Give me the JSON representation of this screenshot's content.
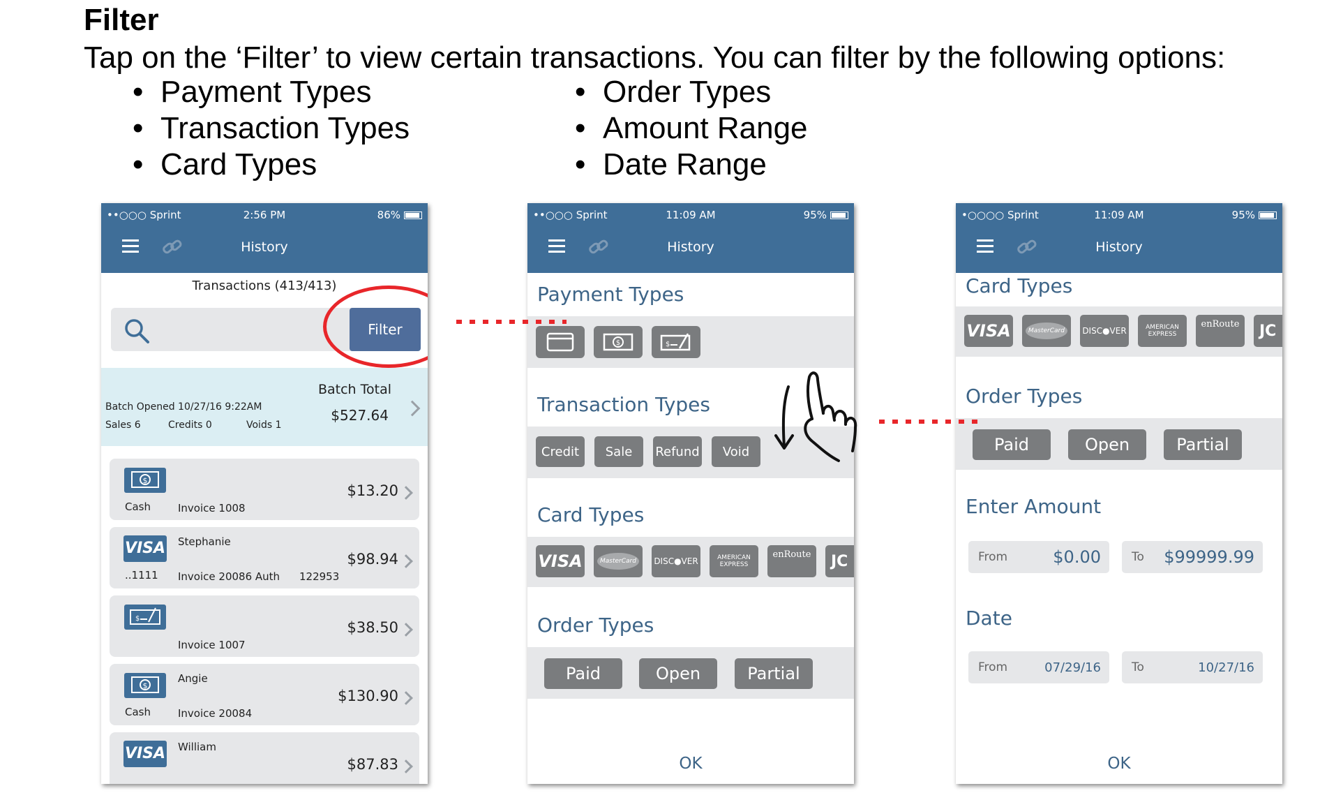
{
  "doc": {
    "title": "Filter",
    "intro": "Tap on the ‘Filter’ to view certain transactions. You can filter by the following options:",
    "options_left": [
      "Payment Types",
      "Transaction Types",
      "Card Types"
    ],
    "options_right": [
      "Order Types",
      "Amount Range",
      "Date Range"
    ]
  },
  "phones": [
    {
      "carrier": "••○○○ Sprint",
      "time": "2:56 PM",
      "battery": "86%",
      "title": "History"
    },
    {
      "carrier": "••○○○ Sprint",
      "time": "11:09 AM",
      "battery": "95%",
      "title": "History"
    },
    {
      "carrier": "•○○○○ Sprint",
      "time": "11:09 AM",
      "battery": "95%",
      "title": "History"
    }
  ],
  "history": {
    "header": "Transactions (413/413)",
    "filter_label": "Filter",
    "batch": {
      "label": "Batch Total",
      "amount": "$527.64",
      "opened": "Batch Opened 10/27/16 9:22AM",
      "sales": "Sales 6",
      "credits": "Credits   0",
      "voids": "Voids   1"
    },
    "rows": [
      {
        "icon": "cash-icon",
        "name": "",
        "payment": "Cash",
        "invoice": "Invoice 1008",
        "auth": "",
        "amount": "$13.20"
      },
      {
        "icon": "visa-icon",
        "name": "Stephanie",
        "payment": "..1111",
        "invoice": "Invoice 20086  Auth",
        "auth": "122953",
        "amount": "$98.94"
      },
      {
        "icon": "check-icon",
        "name": "",
        "payment": "",
        "invoice": "Invoice 1007",
        "auth": "",
        "amount": "$38.50"
      },
      {
        "icon": "cash-icon",
        "name": "Angie",
        "payment": "Cash",
        "invoice": "Invoice 20084",
        "auth": "",
        "amount": "$130.90"
      },
      {
        "icon": "visa-icon",
        "name": "William",
        "payment": "",
        "invoice": "",
        "auth": "",
        "amount": "$87.83"
      }
    ]
  },
  "filter": {
    "payment_types": "Payment Types",
    "transaction_types": "Transaction Types",
    "transaction_chips": [
      "Credit",
      "Sale",
      "Refund",
      "Void"
    ],
    "card_types": "Card Types",
    "card_chips": [
      "VISA",
      "MasterCard",
      "DISC●VER",
      "AMERICAN EXPRESS",
      "enRoute",
      "JC"
    ],
    "order_types": "Order Types",
    "order_chips": [
      "Paid",
      "Open",
      "Partial"
    ],
    "enter_amount": "Enter Amount",
    "amount_from_label": "From",
    "amount_from": "$0.00",
    "amount_to_label": "To",
    "amount_to": "$99999.99",
    "date": "Date",
    "date_from_label": "From",
    "date_from": "07/29/16",
    "date_to_label": "To",
    "date_to": "10/27/16",
    "ok": "OK"
  },
  "colors": {
    "header": "#3f6e98",
    "accent_text": "#3d6487",
    "chip": "#7a7c7e",
    "highlight": "#e8262a",
    "batch_bg": "#dbeef3"
  }
}
